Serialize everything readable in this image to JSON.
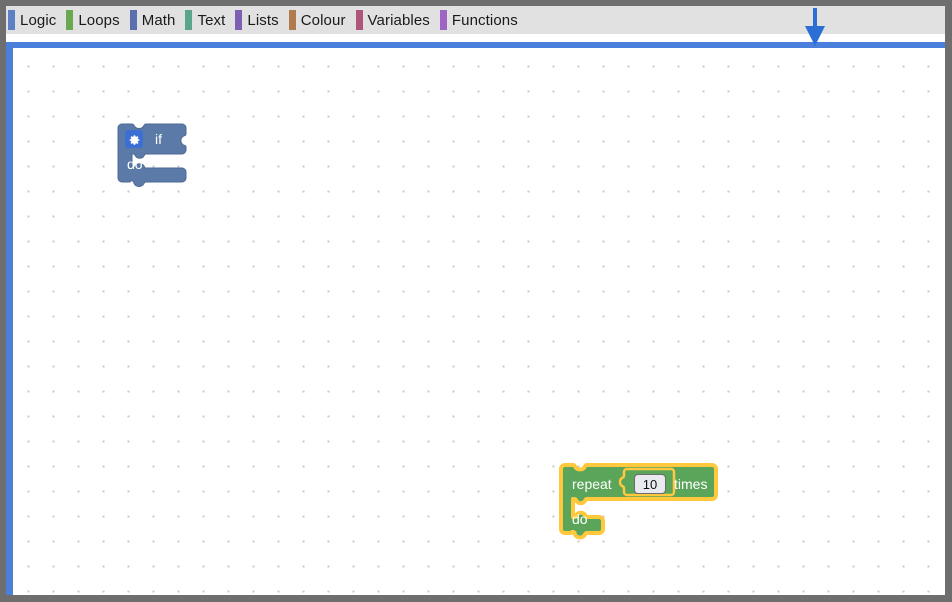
{
  "window": {
    "frame_color": "#6e6e6e",
    "canvas_background": "#ffffff",
    "grid_dot_color": "#c9c9c9",
    "grid_spacing_px": 25
  },
  "toolbox": {
    "background": "#e1e1e1",
    "rule_color": "#4a7fdc",
    "categories": [
      {
        "label": "Logic",
        "color": "#5b80c4",
        "name": "logic"
      },
      {
        "label": "Loops",
        "color": "#6aa84f",
        "name": "loops"
      },
      {
        "label": "Math",
        "color": "#5b6fb0",
        "name": "math"
      },
      {
        "label": "Text",
        "color": "#5ba58c",
        "name": "text"
      },
      {
        "label": "Lists",
        "color": "#7c5fb5",
        "name": "lists"
      },
      {
        "label": "Colour",
        "color": "#b07c4f",
        "name": "colour"
      },
      {
        "label": "Variables",
        "color": "#b0557a",
        "name": "variables"
      },
      {
        "label": "Functions",
        "color": "#a065c4",
        "name": "functions"
      }
    ]
  },
  "workspace": {
    "blocks": [
      {
        "type": "controls_if",
        "name": "if-block",
        "fill": "#5b7aa8",
        "stroke": "#4d6a94",
        "mutator_icon": "gear-icon",
        "mutator_bg": "#3b6fd4",
        "selected": false,
        "labels": {
          "if": "if",
          "do": "do"
        }
      },
      {
        "type": "controls_repeat_ext",
        "name": "repeat-block",
        "fill": "#5ba55b",
        "stroke": "#4c9149",
        "selected": true,
        "highlight_color": "#ffc83d",
        "labels": {
          "repeat": "repeat",
          "times": "times",
          "do": "do"
        },
        "number_field": {
          "name": "repeat-count-field",
          "value": "10",
          "background": "#e9eaef",
          "border": "#6b6b6b",
          "text_color": "#101010"
        }
      }
    ]
  },
  "pointer": {
    "name": "down-arrow-cursor",
    "color": "#2b6fd4",
    "direction": "down"
  }
}
